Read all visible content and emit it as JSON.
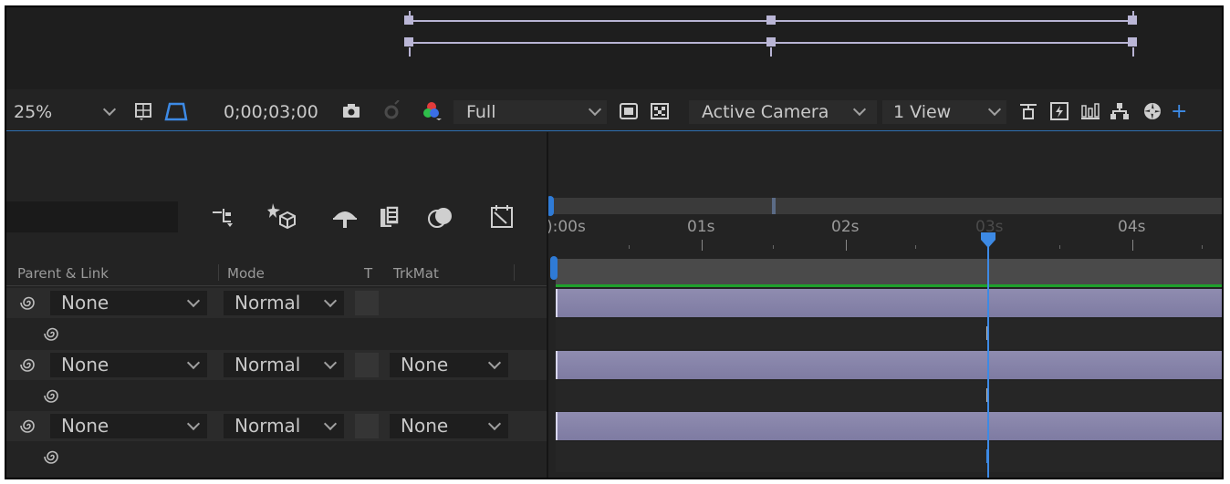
{
  "viewer_toolbar": {
    "zoom_value": "25%",
    "timecode": "0;00;03;00",
    "resolution_value": "Full",
    "camera_view_value": "Active Camera",
    "views_layout_value": "1 View"
  },
  "timeline": {
    "ruler_labels": [
      "):00s",
      "01s",
      "02s",
      "03s",
      "04s"
    ],
    "column_headers": {
      "parent_link": "Parent & Link",
      "mode": "Mode",
      "t": "T",
      "trkmat": "TrkMat"
    },
    "layers": [
      {
        "parent": "None",
        "mode": "Normal",
        "trkmat": ""
      },
      {
        "parent": "None",
        "mode": "Normal",
        "trkmat": "None"
      },
      {
        "parent": "None",
        "mode": "Normal",
        "trkmat": "None"
      }
    ]
  },
  "colors": {
    "accent": "#3d8ae5",
    "layer_bar": "#8f8cb0",
    "work_area_green": "#1fa12c",
    "panel_bg": "#232323"
  },
  "icons": [
    "region-of-interest-icon",
    "transparency-grid-mask-icon",
    "camera-snapshot-icon",
    "show-snapshot-icon",
    "color-channels-icon",
    "fast-previews-icon",
    "transparency-grid-icon",
    "3d-ground-plane-icon",
    "draft-3d-icon",
    "flowchart-icon",
    "exposure-icon",
    "comp-flowchart-icon",
    "draft-3d-toggle-icon",
    "frame-blending-icon",
    "motion-blur-icon",
    "graph-editor-icon",
    "playhead-icon",
    "swirl-parent-icon",
    "annotation-arrow-icon"
  ]
}
